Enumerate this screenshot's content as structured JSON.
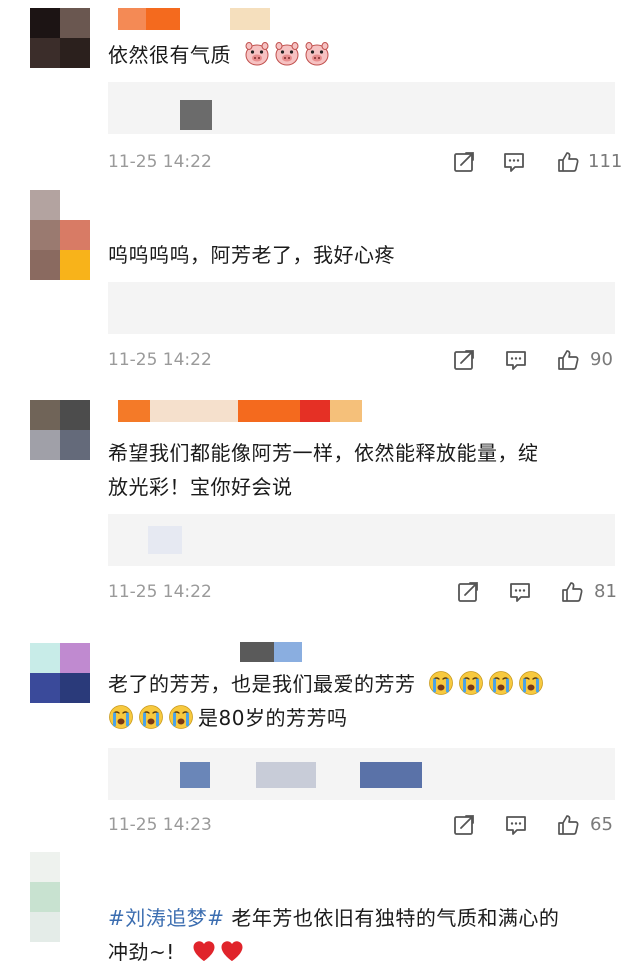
{
  "comments": [
    {
      "text": "依然很有气质",
      "emoji": [
        "pig-face-icon",
        "pig-face-icon",
        "pig-face-icon"
      ],
      "time": "11-25 14:22",
      "likes": "111"
    },
    {
      "text": "呜呜呜呜，阿芳老了，我好心疼",
      "time": "11-25 14:22",
      "likes": "90"
    },
    {
      "text_line1": "希望我们都能像阿芳一样，依然能释放能量，绽",
      "text_line2": "放光彩！宝你好会说",
      "time": "11-25 14:22",
      "likes": "81"
    },
    {
      "text_line1": "老了的芳芳，也是我们最爱的芳芳",
      "text_line2": "是80岁的芳芳吗",
      "emoji": [
        "crying-face-icon"
      ],
      "time": "11-25 14:23",
      "likes": "65"
    },
    {
      "hashtag": "#刘涛追梦#",
      "text_line1": " 老年芳也依旧有独特的气质和满心的",
      "text_line2": "冲劲~!",
      "emoji": [
        "red-heart-icon"
      ]
    }
  ],
  "colors": {
    "text": "#1a1a1a",
    "meta": "#9a9a9a",
    "hashtag": "#3b6db0",
    "heart": "#e0242b"
  }
}
